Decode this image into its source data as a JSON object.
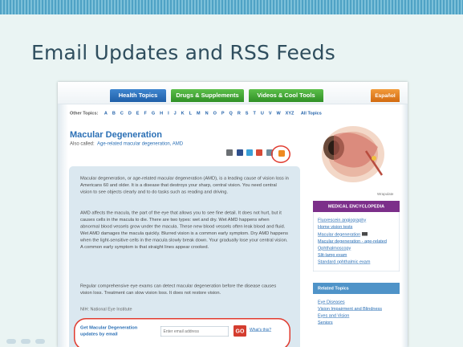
{
  "slide": {
    "title": "Email Updates and RSS Feeds"
  },
  "nav": {
    "tabs": [
      "Health Topics",
      "Drugs & Supplements",
      "Videos & Cool Tools",
      "Español"
    ]
  },
  "topics_row": {
    "label": "Other Topics:",
    "letters": [
      "A",
      "B",
      "C",
      "D",
      "E",
      "F",
      "G",
      "H",
      "I",
      "J",
      "K",
      "L",
      "M",
      "N",
      "O",
      "P",
      "Q",
      "R",
      "S",
      "T",
      "U",
      "V",
      "W",
      "XYZ"
    ],
    "all_label": "All Topics"
  },
  "article": {
    "title": "Macular Degeneration",
    "also_called_label": "Also called:",
    "also_called_value": "Age-related macular degeneration, AMD",
    "paragraphs": [
      "Macular degeneration, or age-related macular degeneration (AMD), is a leading cause of vision loss in Americans 60 and older. It is a disease that destroys your sharp, central vision. You need central vision to see objects clearly and to do tasks such as reading and driving.",
      "AMD affects the macula, the part of the eye that allows you to see fine detail. It does not hurt, but it causes cells in the macula to die. There are two types: wet and dry. Wet AMD happens when abnormal blood vessels grow under the macula. These new blood vessels often leak blood and fluid. Wet AMD damages the macula quickly. Blurred vision is a common early symptom. Dry AMD happens when the light-sensitive cells in the macula slowly break down. Your gradually lose your central vision. A common early symptom is that straight lines appear crooked.",
      "Regular comprehensive eye exams can detect macular degeneration before the disease causes vision loss. Treatment can slow vision loss. It does not restore vision."
    ],
    "source": "NIH: National Eye Institute",
    "image_label": "Wrapulate"
  },
  "email_signup": {
    "text": "Get Macular Degeneration updates by email",
    "placeholder": "Enter email address",
    "go_label": "GO",
    "whats_this": "What's this?"
  },
  "encyclopedia": {
    "header": "MEDICAL ENCYCLOPEDIA",
    "links": [
      "Fluorescein angiography",
      "Home vision tests",
      "Macular degeneration",
      "Macular degeneration - age-related",
      "Ophthalmoscopy",
      "Slit-lamp exam",
      "Standard ophthalmic exam"
    ]
  },
  "related": {
    "header": "Related Topics",
    "links": [
      "Eye Diseases",
      "Vision Impairment and Blindness",
      "Eyes and Vision",
      "Seniors"
    ]
  },
  "colors": {
    "accent_blue": "#2a6fb5",
    "highlight_red": "#e03b2f",
    "rss_orange": "#ee8a21",
    "encyclopedia_purple": "#7c2f8a"
  }
}
